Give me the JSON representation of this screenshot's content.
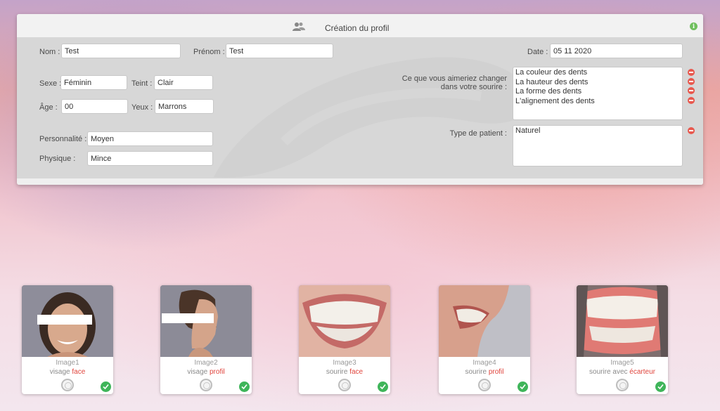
{
  "header": {
    "title": "Création du profil",
    "title_icon": "users-icon",
    "info_icon": "info-icon",
    "info_glyph": "i"
  },
  "form": {
    "nom": {
      "label": "Nom :",
      "value": "Test"
    },
    "prenom": {
      "label": "Prénom :",
      "value": "Test"
    },
    "date": {
      "label": "Date :",
      "value": "05 11 2020"
    },
    "sexe": {
      "label": "Sexe :",
      "value": "Féminin"
    },
    "teint": {
      "label": "Teint :",
      "value": "Clair"
    },
    "age": {
      "label": "Âge :",
      "value": "00"
    },
    "yeux": {
      "label": "Yeux :",
      "value": "Marrons"
    },
    "personnalite": {
      "label": "Personnalité :",
      "value": "Moyen"
    },
    "physique": {
      "label": "Physique :",
      "value": "Mince"
    },
    "changes": {
      "label_line1": "Ce que vous aimeriez changer",
      "label_line2": "dans votre sourire :",
      "items": [
        "La couleur des dents",
        "La hauteur des dents",
        "La forme des dents",
        "L'alignement des dents"
      ]
    },
    "patient_type": {
      "label": "Type de patient :",
      "items": [
        "Naturel"
      ]
    }
  },
  "images": [
    {
      "title": "Image1",
      "desc": "visage ",
      "accent": "face"
    },
    {
      "title": "Image2",
      "desc": "visage ",
      "accent": "profil"
    },
    {
      "title": "Image3",
      "desc": "sourire ",
      "accent": "face"
    },
    {
      "title": "Image4",
      "desc": "sourire ",
      "accent": "profil"
    },
    {
      "title": "Image5",
      "desc": "sourire avec ",
      "accent": "écarteur"
    }
  ],
  "colors": {
    "accent_red": "#e0443c",
    "check_green": "#3fb55a",
    "remove_red": "#e8584e",
    "info_green": "#6fbf5d"
  }
}
